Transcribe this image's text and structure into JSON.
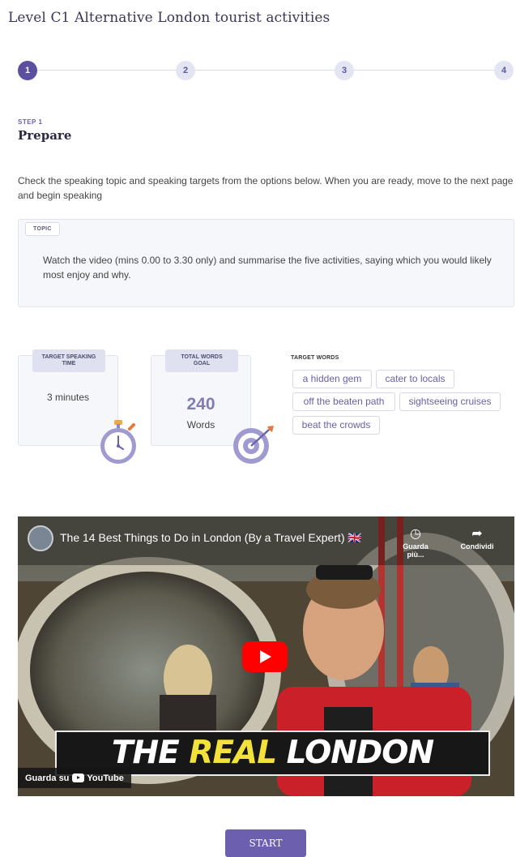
{
  "page": {
    "title": "Level C1 Alternative London tourist activities"
  },
  "stepper": {
    "steps": [
      {
        "label": "1",
        "active": true
      },
      {
        "label": "2",
        "active": false
      },
      {
        "label": "3",
        "active": false
      },
      {
        "label": "4",
        "active": false
      }
    ]
  },
  "step": {
    "kicker": "STEP 1",
    "heading": "Prepare",
    "instructions": "Check the speaking topic and speaking targets from the options below. When you are ready, move to the next page and begin speaking"
  },
  "topic": {
    "tag": "TOPIC",
    "text": "Watch the video (mins 0.00 to 3.30 only) and summarise the five activities, saying which you would likely most enjoy and why."
  },
  "targets": {
    "time": {
      "tag_line1": "TARGET SPEAKING",
      "tag_line2": "TIME",
      "value": "3 minutes",
      "icon": "stopwatch-icon"
    },
    "words": {
      "tag_line1": "TOTAL WORDS",
      "tag_line2": "GOAL",
      "number": "240",
      "unit": "Words",
      "icon": "target-icon"
    },
    "target_words_heading": "TARGET WORDS",
    "target_words": [
      "a hidden gem",
      "cater to locals",
      "off the beaten path",
      "sightseeing cruises",
      "beat the crowds"
    ]
  },
  "video": {
    "title": "The 14 Best Things to Do in London (By a Travel Expert) 🇬🇧",
    "watch_later": "Guarda più...",
    "share": "Condividi",
    "banner_word1": "THE",
    "banner_word2": "REAL",
    "banner_word3": "LONDON",
    "watch_on": "Guarda su",
    "youtube": "YouTube",
    "colors": {
      "play": "#ff0000",
      "highlight": "#f4e23c"
    }
  },
  "actions": {
    "start": "START"
  },
  "colors": {
    "accent": "#6c5fad",
    "step_active": "#5b4fa0",
    "number": "#7f7cb6"
  }
}
